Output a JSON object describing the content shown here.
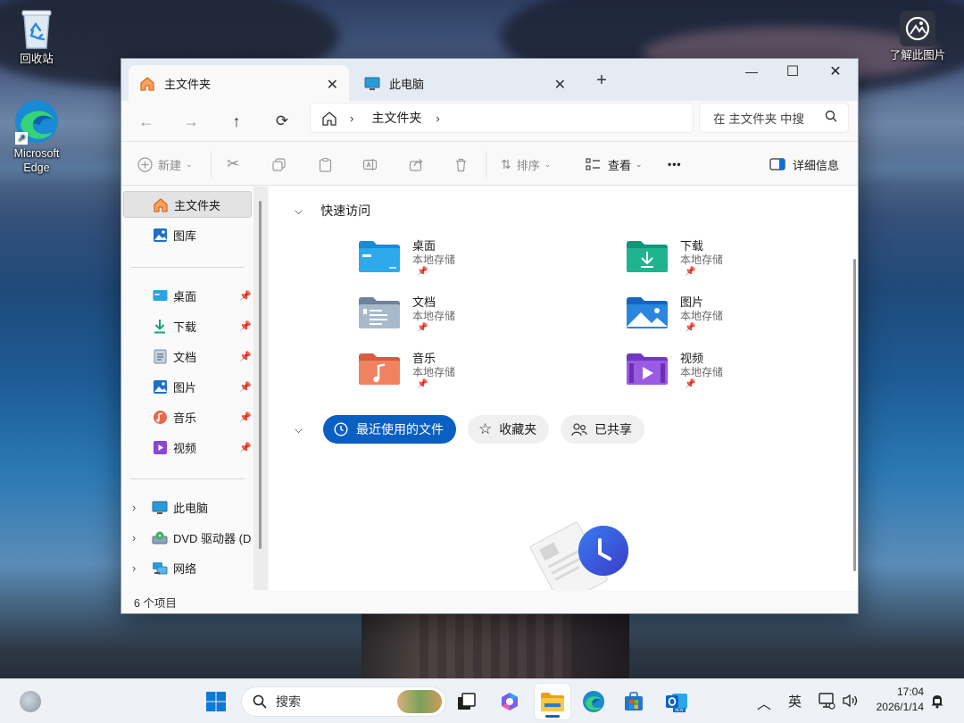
{
  "desktop": {
    "icons": [
      {
        "label": "回收站",
        "icon": "recycle-bin-icon"
      },
      {
        "label": "Microsoft Edge",
        "icon": "edge-icon"
      },
      {
        "label": "了解此图片",
        "icon": "spotlight-icon"
      }
    ]
  },
  "window": {
    "tabs": [
      {
        "label": "主文件夹",
        "icon": "home-icon",
        "active": true
      },
      {
        "label": "此电脑",
        "icon": "monitor-icon",
        "active": false
      }
    ],
    "controls": {
      "minimize": "—",
      "maximize": "☐",
      "close": "✕",
      "new_tab": "+"
    },
    "address": {
      "crumbs": [
        "主文件夹"
      ]
    },
    "search": {
      "placeholder": "在 主文件夹 中搜"
    },
    "commands": {
      "new_label": "新建",
      "sort_label": "排序",
      "view_label": "查看",
      "more_label": "•••",
      "details_label": "详细信息"
    },
    "sidebar": {
      "top": [
        {
          "label": "主文件夹",
          "icon": "home-icon"
        },
        {
          "label": "图库",
          "icon": "gallery-icon"
        }
      ],
      "pinned": [
        {
          "label": "桌面",
          "icon": "desktop-folder-icon"
        },
        {
          "label": "下载",
          "icon": "download-icon"
        },
        {
          "label": "文档",
          "icon": "document-icon"
        },
        {
          "label": "图片",
          "icon": "pictures-icon"
        },
        {
          "label": "音乐",
          "icon": "music-icon"
        },
        {
          "label": "视频",
          "icon": "video-icon"
        }
      ],
      "devices": [
        {
          "label": "此电脑",
          "icon": "monitor-icon"
        },
        {
          "label": "DVD 驱动器 (D",
          "icon": "dvd-drive-icon"
        },
        {
          "label": "网络",
          "icon": "network-icon"
        }
      ]
    },
    "quick_access": {
      "title": "快速访问",
      "items": [
        {
          "name": "桌面",
          "sub": "本地存储"
        },
        {
          "name": "下载",
          "sub": "本地存储"
        },
        {
          "name": "文档",
          "sub": "本地存储"
        },
        {
          "name": "图片",
          "sub": "本地存储"
        },
        {
          "name": "音乐",
          "sub": "本地存储"
        },
        {
          "name": "视频",
          "sub": "本地存储"
        }
      ]
    },
    "recent_tabs": [
      "最近使用的文件",
      "收藏夹",
      "已共享"
    ],
    "status": "6 个项目"
  },
  "taskbar": {
    "search_placeholder": "搜索",
    "ime": "英",
    "time": "17:04",
    "date": "2026/1/14",
    "accent": "#0067c0"
  }
}
